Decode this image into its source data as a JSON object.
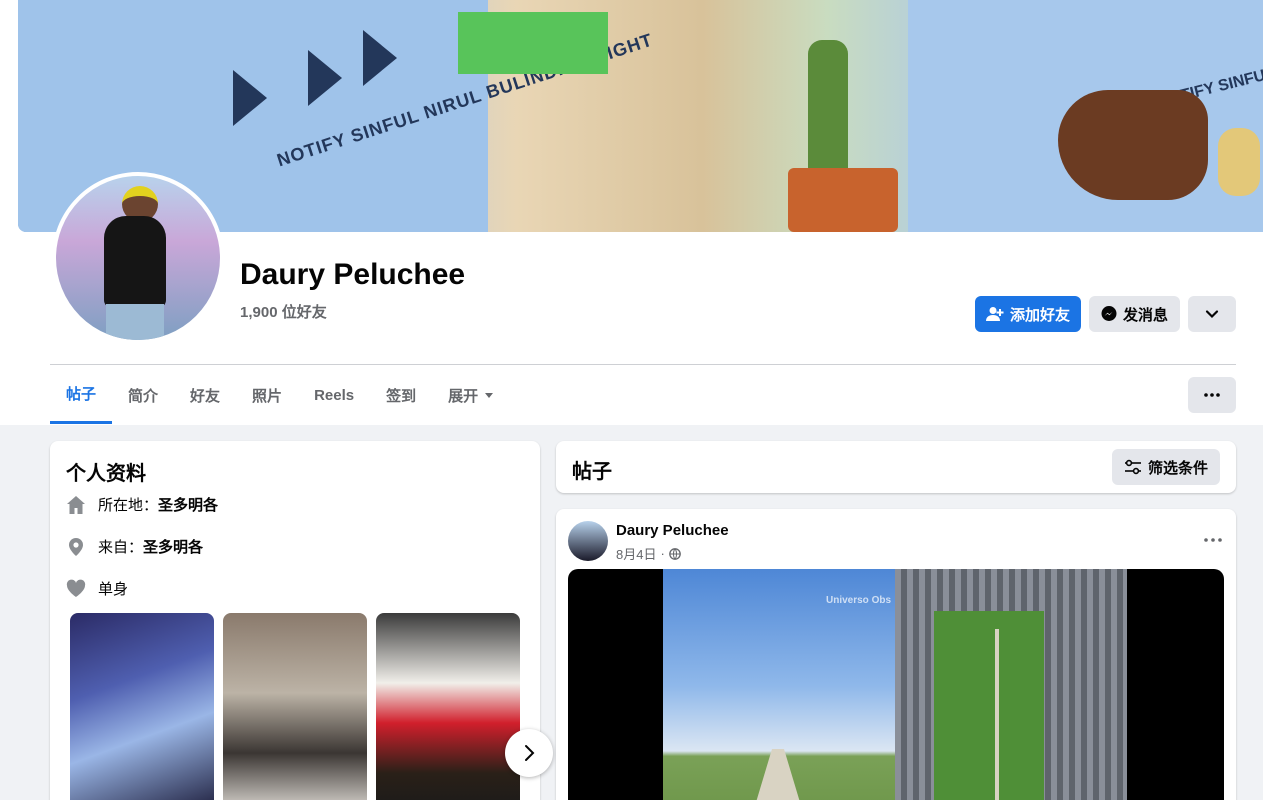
{
  "profile": {
    "name": "Daury Peluchee",
    "friends_count": "1,900 位好友"
  },
  "cover": {
    "brand_left": "NOTIFY SINFUL NIRUL BULINDING LIGHT",
    "brand_right": "NOTIFY SINFUL NIRUL BULINDING LIGHT"
  },
  "actions": {
    "add_friend": "添加好友",
    "message": "发消息"
  },
  "tabs": [
    {
      "label": "帖子",
      "active": true
    },
    {
      "label": "简介"
    },
    {
      "label": "好友"
    },
    {
      "label": "照片"
    },
    {
      "label": "Reels"
    },
    {
      "label": "签到"
    },
    {
      "label": "展开"
    }
  ],
  "intro": {
    "title": "个人资料",
    "lives_label": "所在地：",
    "lives_value": "圣多明各",
    "from_label": "来自：",
    "from_value": "圣多明各",
    "relationship": "单身"
  },
  "posts": {
    "title": "帖子",
    "filter_label": "筛选条件",
    "post": {
      "author": "Daury Peluchee",
      "date": "8月4日",
      "separator": "·",
      "media_watermark": "Universo Obs"
    }
  },
  "colors": {
    "primary": "#1b74e4",
    "background": "#f0f2f5",
    "secondary_button": "#e4e6eb",
    "muted_text": "#65676b"
  }
}
